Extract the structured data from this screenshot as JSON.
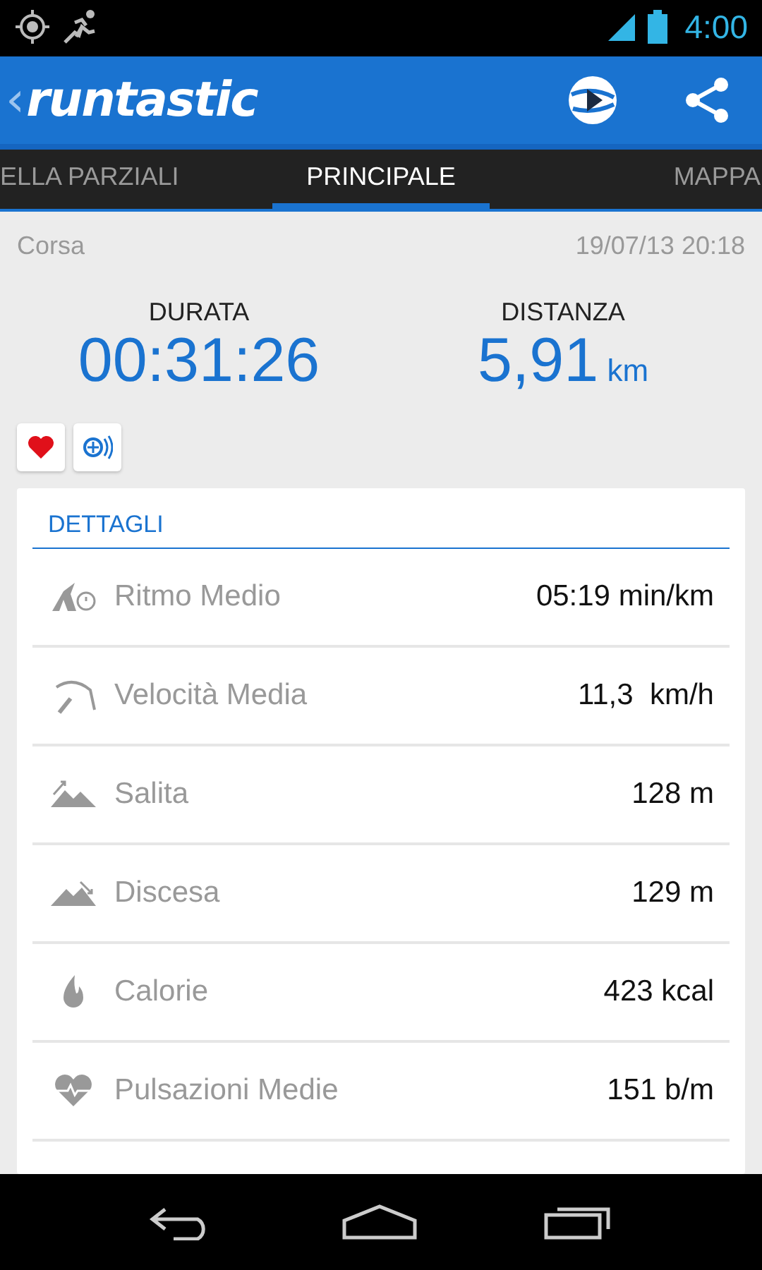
{
  "status_bar": {
    "time": "4:00"
  },
  "app_bar": {
    "back": "‹",
    "logo": "runtastic"
  },
  "tabs": [
    {
      "label": "ELLA PARZIALI",
      "selected": false
    },
    {
      "label": "PRINCIPALE",
      "selected": true
    },
    {
      "label": "MAPPA",
      "selected": false
    }
  ],
  "session": {
    "type": "Corsa",
    "date": "19/07/13 20:18"
  },
  "summary": [
    {
      "label": "DURATA",
      "value": "00:31:26"
    },
    {
      "label": "DISTANZA",
      "value": "5,91",
      "unit": "km"
    }
  ],
  "details": {
    "title": "DETTAGLI",
    "rows": [
      {
        "label": "Ritmo Medio",
        "value": "05:19 min/km"
      },
      {
        "label": "Velocità Media",
        "value": "11,3  km/h"
      },
      {
        "label": "Salita",
        "value": "128 m"
      },
      {
        "label": "Discesa",
        "value": "129 m"
      },
      {
        "label": "Calorie",
        "value": "423 kcal"
      },
      {
        "label": "Pulsazioni Medie",
        "value": "151 b/m"
      }
    ]
  }
}
